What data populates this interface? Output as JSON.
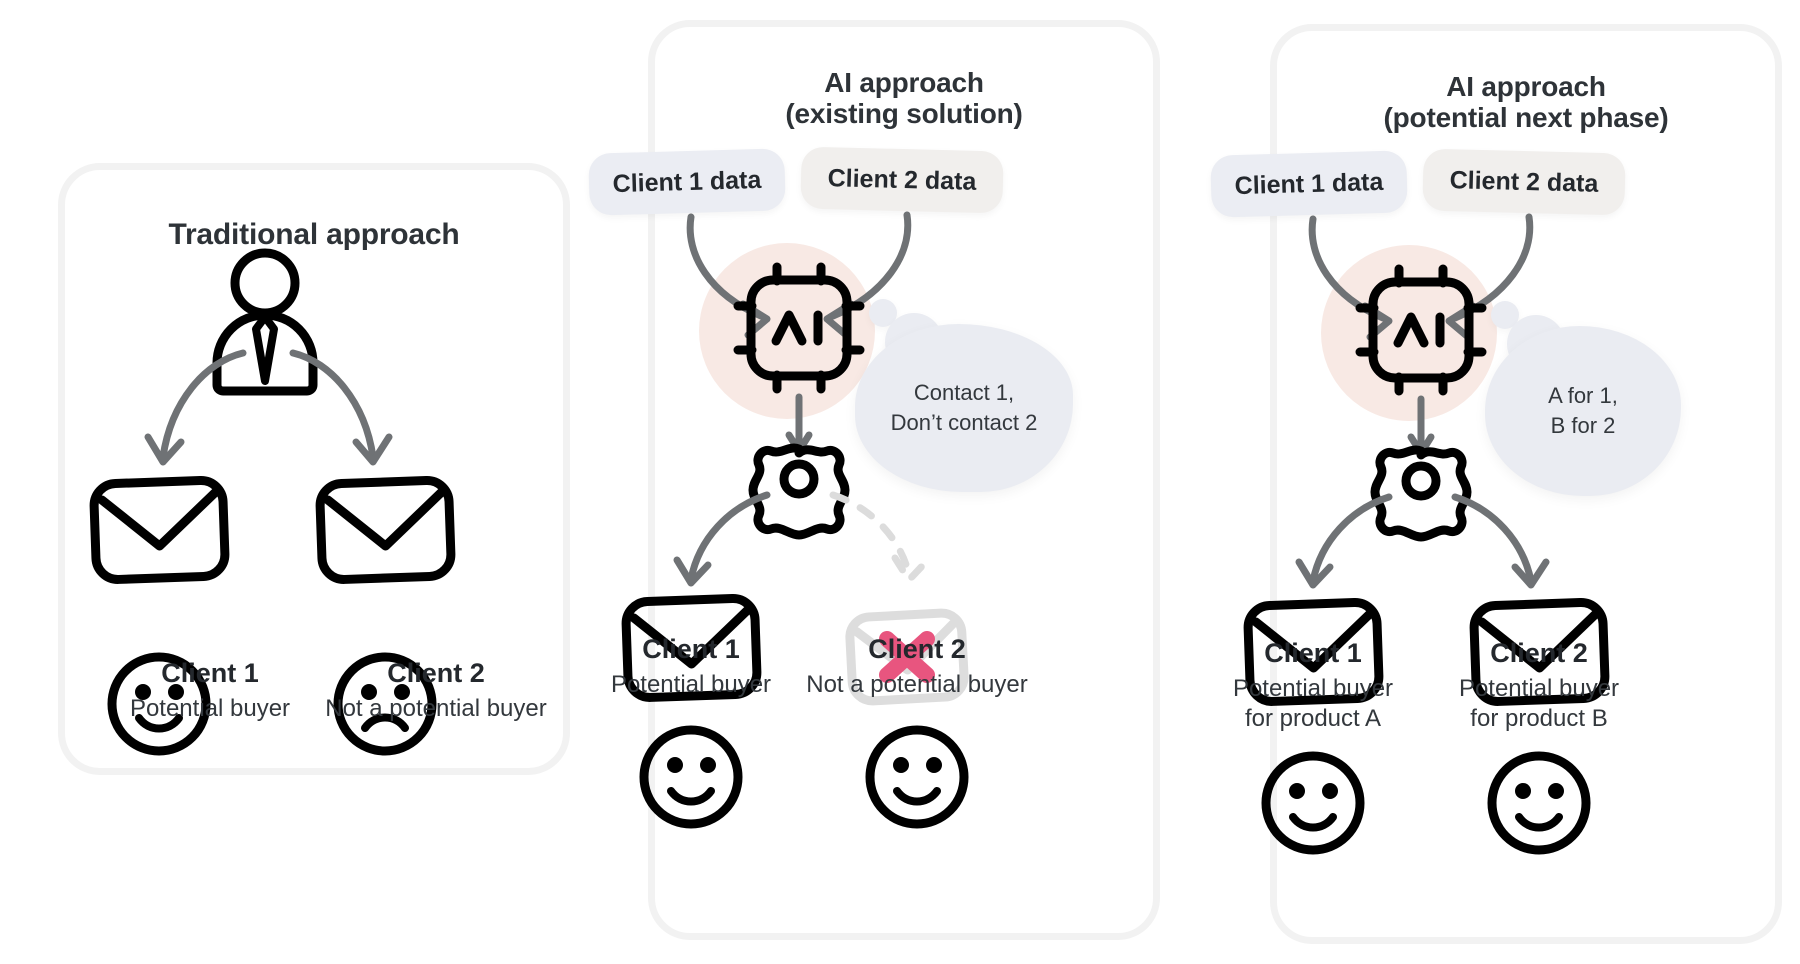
{
  "panels": [
    {
      "id": "traditional",
      "title": "Traditional approach",
      "subtitle": "",
      "clients": [
        {
          "name": "Client 1",
          "desc": "Potential buyer",
          "mood": "happy"
        },
        {
          "name": "Client 2",
          "desc": "Not a potential buyer",
          "mood": "sad"
        }
      ]
    },
    {
      "id": "existing",
      "title": "AI approach",
      "subtitle": "(existing solution)",
      "data_pills": [
        {
          "label": "Client 1 data",
          "tone": "cool"
        },
        {
          "label": "Client 2 data",
          "tone": "warm"
        }
      ],
      "ai_icon_label": "AI",
      "bubble_lines": [
        "Contact 1,",
        "Don’t contact 2"
      ],
      "clients": [
        {
          "name": "Client 1",
          "desc": "Potential buyer",
          "mood": "happy",
          "mail": "sent"
        },
        {
          "name": "Client 2",
          "desc": "Not a potential buyer",
          "mood": "happy",
          "mail": "blocked"
        }
      ]
    },
    {
      "id": "next",
      "title": "AI approach",
      "subtitle": "(potential next phase)",
      "data_pills": [
        {
          "label": "Client 1 data",
          "tone": "cool"
        },
        {
          "label": "Client 2 data",
          "tone": "warm"
        }
      ],
      "ai_icon_label": "AI",
      "bubble_lines": [
        "A for 1,",
        "B for 2"
      ],
      "clients": [
        {
          "name": "Client 1",
          "desc": "Potential buyer\nfor product A",
          "mood": "happy",
          "mail": "sent"
        },
        {
          "name": "Client 2",
          "desc": "Potential buyer\nfor product B",
          "mood": "happy",
          "mail": "sent"
        }
      ]
    }
  ],
  "colors": {
    "card_border": "#f2f2f2",
    "pill_cool": "#ebedf3",
    "pill_warm": "#f1efed",
    "ai_blob": "#f8e9e4",
    "bubble": "#eaecf2",
    "arrow": "#6f7275",
    "arrow_muted": "#dcdcdc",
    "x_mark": "#e8557f",
    "ink": "#000000",
    "text": "#24282d"
  }
}
